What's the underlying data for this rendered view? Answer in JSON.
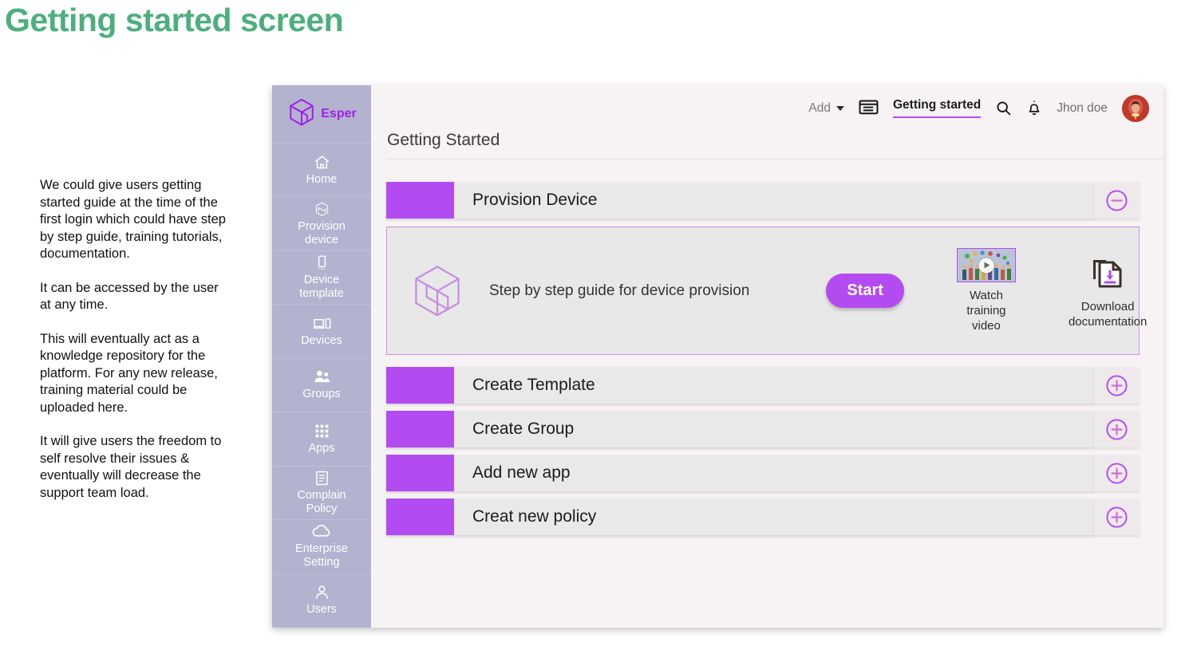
{
  "slide": {
    "title": "Getting started screen",
    "title_color": "#4caf7d",
    "notes": [
      "We could give users getting started guide at the time of the first login which could have step by step guide, training tutorials, documentation.",
      "It can be accessed by the user at any time.",
      "This will eventually act as a knowledge repository for the platform. For any new release, training material could be uploaded here.",
      "It will give users the freedom to self resolve their issues & eventually will decrease the support team load."
    ]
  },
  "app": {
    "brand": {
      "name": "Esper",
      "logo_icon": "esper-hexagon-logo-icon",
      "color": "#a020e8"
    },
    "accent_color": "#b44bf0",
    "sidebar_color": "#b3b2cf",
    "sidebar": {
      "items": [
        {
          "label": "Home",
          "icon": "home-icon"
        },
        {
          "label": "Provision\ndevice",
          "icon": "provision-hexagon-icon"
        },
        {
          "label": "Device\ntemplate",
          "icon": "phone-template-icon"
        },
        {
          "label": "Devices",
          "icon": "devices-laptop-phone-icon"
        },
        {
          "label": "Groups",
          "icon": "groups-people-icon"
        },
        {
          "label": "Apps",
          "icon": "apps-grid-icon"
        },
        {
          "label": "Complain\nPolicy",
          "icon": "document-list-icon"
        },
        {
          "label": "Enterprise\nSetting",
          "icon": "cloud-icon"
        },
        {
          "label": "Users",
          "icon": "user-person-icon"
        }
      ]
    },
    "topbar": {
      "add_label": "Add",
      "add_caret_icon": "chevron-down-icon",
      "dashboard_icon": "dashboard-window-icon",
      "active_tab": "Getting started",
      "search_icon": "search-icon",
      "notification_icon": "bell-icon",
      "user_name": "Jhon doe",
      "avatar_icon": "avatar",
      "avatar_color": "#c0392b"
    },
    "page_heading": "Getting Started",
    "rows": [
      {
        "title": "Provision Device",
        "expanded": true,
        "toggle_icon": "minus-circle-icon"
      },
      {
        "title": "Create Template",
        "expanded": false,
        "toggle_icon": "plus-circle-icon"
      },
      {
        "title": "Create Group",
        "expanded": false,
        "toggle_icon": "plus-circle-icon"
      },
      {
        "title": "Add new app",
        "expanded": false,
        "toggle_icon": "plus-circle-icon"
      },
      {
        "title": "Creat new policy",
        "expanded": false,
        "toggle_icon": "plus-circle-icon"
      }
    ],
    "expanded_panel": {
      "logo_icon": "esper-hexagon-outline-icon",
      "text": "Step by step guide for device provision",
      "start_label": "Start",
      "tiles": [
        {
          "label": "Watch training video",
          "icon": "video-thumbnail-play-icon"
        },
        {
          "label": "Download documentation",
          "icon": "download-document-icon"
        }
      ]
    }
  }
}
